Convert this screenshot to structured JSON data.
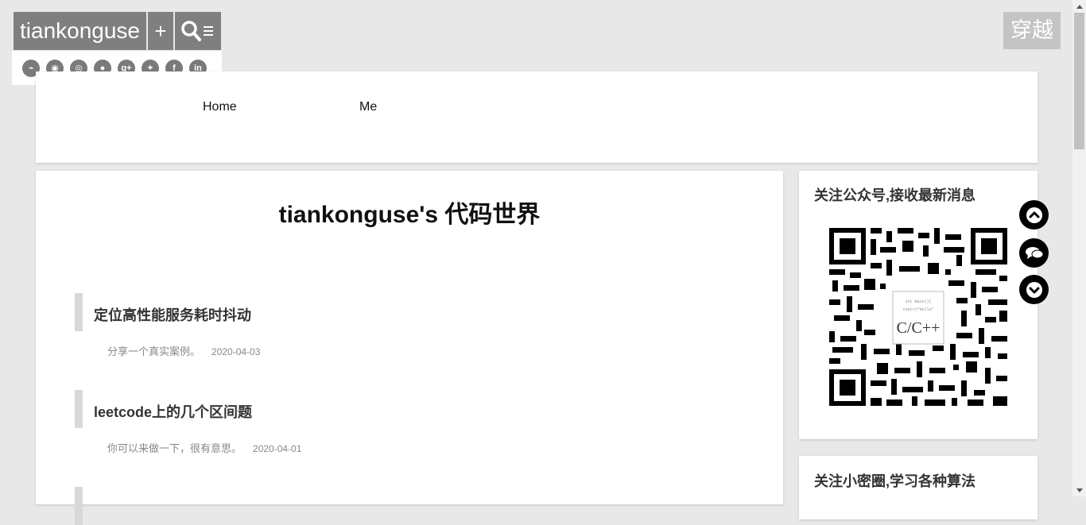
{
  "header": {
    "brand_title": "tiankonguse",
    "plus_label": "+",
    "search_menu_icon": "search-menu-icon",
    "switch_label": "穿越"
  },
  "social_links": [
    {
      "name": "rss-icon",
      "glyph": "⌁"
    },
    {
      "name": "github-icon",
      "glyph": "◉"
    },
    {
      "name": "weibo-icon",
      "glyph": "◎"
    },
    {
      "name": "wechat-icon",
      "glyph": "●"
    },
    {
      "name": "google-plus-icon",
      "glyph": "g+"
    },
    {
      "name": "twitter-icon",
      "glyph": "✦"
    },
    {
      "name": "facebook-icon",
      "glyph": "f"
    },
    {
      "name": "linkedin-icon",
      "glyph": "in"
    }
  ],
  "nav": {
    "items": [
      {
        "label": "Home"
      },
      {
        "label": "Me"
      }
    ]
  },
  "main": {
    "site_title": "tiankonguse's 代码世界",
    "posts": [
      {
        "title": "定位高性能服务耗时抖动",
        "summary": "分享一个真实案例。",
        "date": "2020-04-03"
      },
      {
        "title": "leetcode上的几个区间题",
        "summary": "你可以来做一下，很有意思。",
        "date": "2020-04-01"
      }
    ]
  },
  "sidebar": {
    "wechat_card_title": "关注公众号,接收最新消息",
    "qr_center_text": "C/C++",
    "circle_card_title": "关注小密圈,学习各种算法"
  },
  "floating_buttons": [
    {
      "name": "scroll-top-icon"
    },
    {
      "name": "comment-icon"
    },
    {
      "name": "scroll-bottom-icon"
    }
  ],
  "colors": {
    "brand_bg": "#7f7f7f",
    "page_bg": "#e8e8e8",
    "switch_bg": "#c4c4c4"
  }
}
